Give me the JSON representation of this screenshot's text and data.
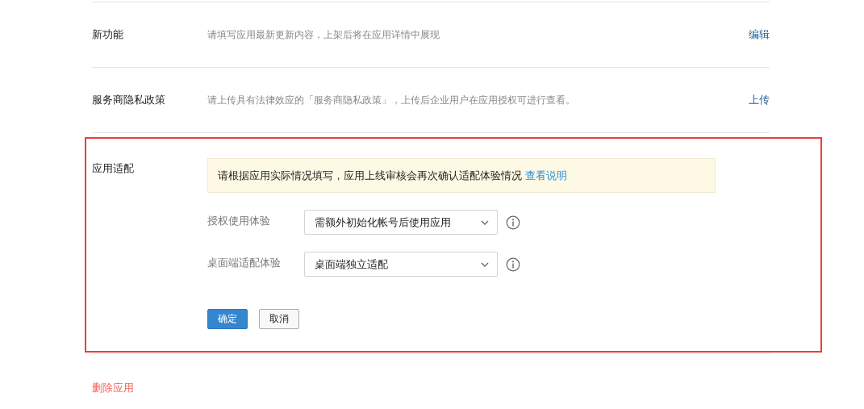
{
  "settings_rows": [
    {
      "label": "新功能",
      "description": "请填写应用最新更新内容，上架后将在应用详情中展现",
      "action": "编辑"
    },
    {
      "label": "服务商隐私政策",
      "description": "请上传具有法律效应的「服务商隐私政策」，上传后企业用户在应用授权可进行查看。",
      "action": "上传"
    }
  ],
  "adaptation_section": {
    "label": "应用适配",
    "highlighted": true,
    "notice": {
      "text": "请根据应用实际情况填写，应用上线审核会再次确认适配体验情况",
      "link": "查看说明"
    },
    "fields": [
      {
        "label": "授权使用体验",
        "value": "需额外初始化帐号后使用应用"
      },
      {
        "label": "桌面端适配体验",
        "value": "桌面端独立适配"
      }
    ],
    "buttons": [
      {
        "label": "确定",
        "kind": "primary"
      },
      {
        "label": "取消",
        "kind": "default"
      }
    ]
  },
  "delete_link": "删除应用"
}
